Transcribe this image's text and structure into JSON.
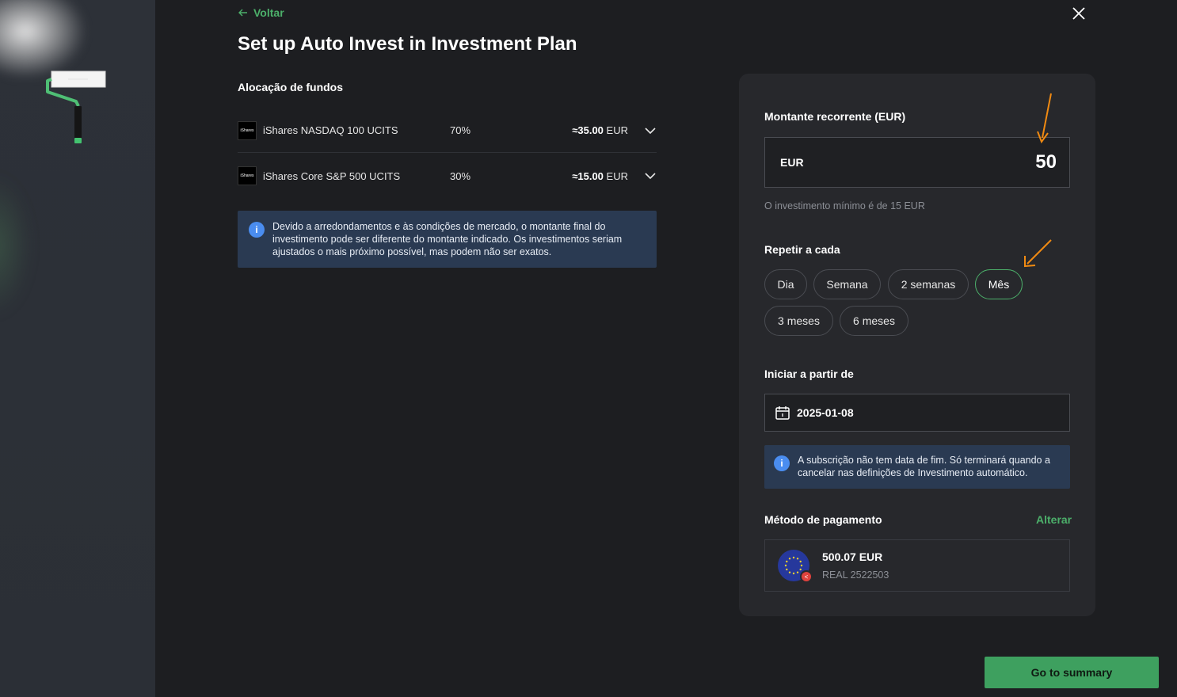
{
  "header": {
    "back_label": "Voltar",
    "title": "Set up Auto Invest in Investment Plan"
  },
  "allocation": {
    "title": "Alocação de fundos",
    "funds": [
      {
        "logo": "iShares",
        "name": "iShares NASDAQ 100 UCITS",
        "pct": "70%",
        "amount": "≈35.00",
        "currency": "EUR"
      },
      {
        "logo": "iShares",
        "name": "iShares Core S&P 500 UCITS",
        "pct": "30%",
        "amount": "≈15.00",
        "currency": "EUR"
      }
    ],
    "notice": "Devido a arredondamentos e às condições de mercado, o montante final do investimento pode ser diferente do montante indicado. Os investimentos seriam ajustados o mais próximo possível, mas podem não ser exatos."
  },
  "form": {
    "amount_label": "Montante recorrente (EUR)",
    "amount_currency": "EUR",
    "amount_value": "50",
    "amount_hint": "O investimento mínimo é de 15 EUR",
    "repeat_label": "Repetir a cada",
    "frequencies": [
      "Dia",
      "Semana",
      "2 semanas",
      "Mês",
      "3 meses",
      "6 meses"
    ],
    "selected_frequency": "Mês",
    "start_label": "Iniciar a partir de",
    "start_date": "2025-01-08",
    "subscription_notice": "A subscrição não tem data de fim. Só terminará quando a cancelar nas definições de Investimento automático.",
    "payment_label": "Método de pagamento",
    "payment_change": "Alterar",
    "payment_amount": "500.07 EUR",
    "payment_account": "REAL 2522503"
  },
  "footer": {
    "summary_button": "Go to summary"
  },
  "colors": {
    "accent_green": "#4caf6a",
    "button_green": "#3ea05f",
    "info_blue": "#4a8df0",
    "annotation_orange": "#f08a12"
  },
  "icons": [
    "arrow-left-icon",
    "close-icon",
    "chevron-down-icon",
    "info-icon",
    "calendar-icon",
    "eu-flag-icon"
  ]
}
